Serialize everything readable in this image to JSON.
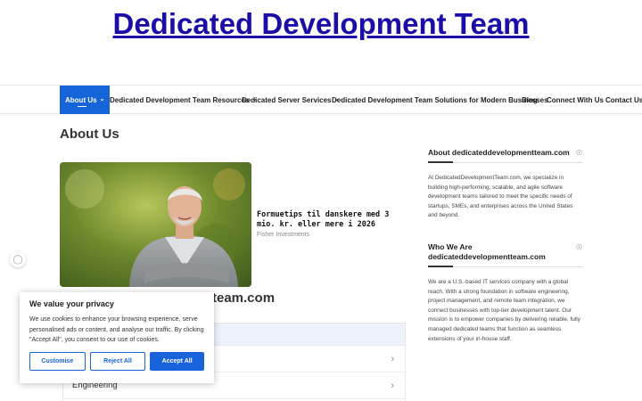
{
  "site": {
    "title": "Dedicated Development Team"
  },
  "nav": {
    "items": [
      {
        "label": "About Us",
        "active": true,
        "dropdown": true
      },
      {
        "label": "Dedicated Development Team Resources",
        "dropdown": true
      },
      {
        "label": "Dedicated Server Services",
        "dropdown": true
      },
      {
        "label": "Dedicated Development Team Solutions for Modern Businesses",
        "dropdown": false
      },
      {
        "label": "Blog",
        "dropdown": false
      },
      {
        "label": "Connect With Us",
        "dropdown": false
      },
      {
        "label": "Contact Us",
        "dropdown": false
      }
    ],
    "active_color": "#1565d8"
  },
  "main": {
    "page_title": "About Us",
    "ad": {
      "title": "Formuetips til danskere med 3 mio. kr. eller mere i 2026",
      "source": "Fisher Investments"
    },
    "heading_visible": "team.com",
    "list": [
      {
        "label": ""
      },
      {
        "label": "Engineering"
      }
    ]
  },
  "sidebar": {
    "widgets": [
      {
        "title": "About dedicateddevelopmentteam.com",
        "text": "At DedicatedDevelopmentTeam.com, we specialize in building high-performing, scalable, and agile software development teams tailored to meet the specific needs of startups, SMEs, and enterprises across the United States and beyond."
      },
      {
        "title": "Who We Are dedicateddevelopmentteam.com",
        "text": "We are a U.S.-based IT services company with a global reach. With a strong foundation in software engineering, project management, and remote team integration, we connect businesses with top-tier development talent. Our mission is to empower companies by delivering reliable, fully managed dedicated teams that function as seamless extensions of your in-house staff."
      }
    ]
  },
  "consent": {
    "title": "We value your privacy",
    "text": "We use cookies to enhance your browsing experience, serve personalised ads or content, and analyse our traffic. By clicking \"Accept All\", you consent to our use of cookies.",
    "buttons": {
      "customise": "Customise",
      "reject": "Reject All",
      "accept": "Accept All"
    },
    "brand_color": "#1863dc"
  }
}
